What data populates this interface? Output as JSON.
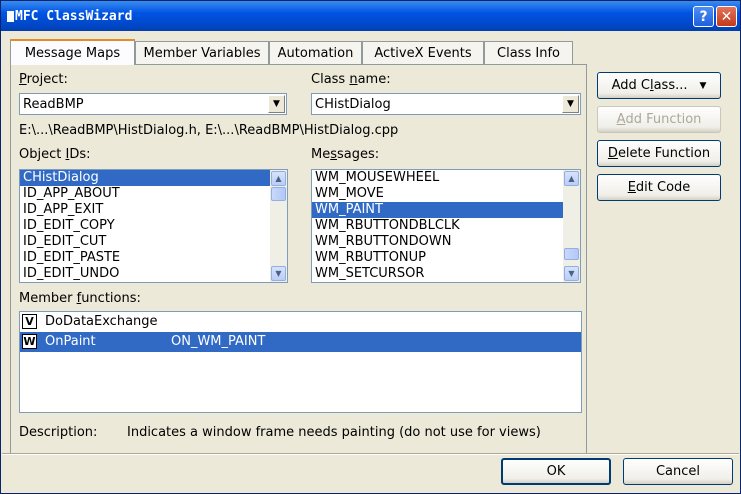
{
  "window": {
    "title": "MFC ClassWizard",
    "help_label": "?",
    "close_label": "✕"
  },
  "tabs": [
    {
      "label": "Message Maps",
      "active": true
    },
    {
      "label": "Member Variables",
      "active": false
    },
    {
      "label": "Automation",
      "active": false
    },
    {
      "label": "ActiveX Events",
      "active": false
    },
    {
      "label": "Class Info",
      "active": false
    }
  ],
  "project": {
    "label_pre": "",
    "label_u": "P",
    "label_post": "roject:",
    "value": "ReadBMP"
  },
  "class_name": {
    "label_pre": "Class ",
    "label_u": "n",
    "label_post": "ame:",
    "value": "CHistDialog"
  },
  "file_path": "E:\\...\\ReadBMP\\HistDialog.h, E:\\...\\ReadBMP\\HistDialog.cpp",
  "object_ids": {
    "label_pre": "Object ",
    "label_u": "I",
    "label_post": "Ds:",
    "items": [
      "CHistDialog",
      "ID_APP_ABOUT",
      "ID_APP_EXIT",
      "ID_EDIT_COPY",
      "ID_EDIT_CUT",
      "ID_EDIT_PASTE",
      "ID_EDIT_UNDO"
    ],
    "selected_index": 0
  },
  "messages": {
    "label_pre": "Me",
    "label_u": "s",
    "label_post": "sages:",
    "items": [
      "WM_MOUSEWHEEL",
      "WM_MOVE",
      "WM_PAINT",
      "WM_RBUTTONDBLCLK",
      "WM_RBUTTONDOWN",
      "WM_RBUTTONUP",
      "WM_SETCURSOR"
    ],
    "selected_index": 2
  },
  "member_functions": {
    "label_pre": "Member ",
    "label_u": "f",
    "label_post": "unctions:",
    "rows": [
      {
        "badge": "V",
        "name": "DoDataExchange",
        "message": ""
      },
      {
        "badge": "W",
        "name": "OnPaint",
        "message": "ON_WM_PAINT"
      }
    ],
    "selected_index": 1
  },
  "description": {
    "label": "Description:",
    "text": "Indicates a window frame needs painting (do not use for views)"
  },
  "buttons": {
    "add_class_pre": "Add C",
    "add_class_u": "l",
    "add_class_post": "ass...",
    "add_class_arrow": "▼",
    "add_function_u": "A",
    "add_function_post": "dd Function",
    "delete_function_u": "D",
    "delete_function_post": "elete Function",
    "edit_code_u": "E",
    "edit_code_post": "dit Code",
    "ok": "OK",
    "cancel": "Cancel"
  }
}
